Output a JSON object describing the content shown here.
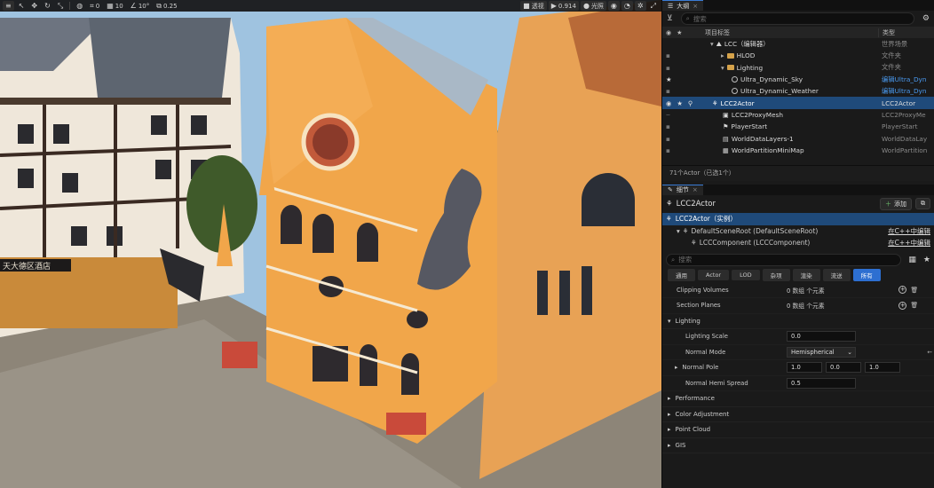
{
  "viewport_toolbar": {
    "grid_snap": "0",
    "grid_size": "10",
    "rotate_snap": "10°",
    "scale_snap": "0.25",
    "view_mode": "透视",
    "camera_speed": "0.914",
    "lit_mode": "光照"
  },
  "signs": {
    "shop_sign": "天大德区酒店"
  },
  "outliner": {
    "tab_title": "大纲",
    "search_placeholder": "搜索",
    "col_label": "项目标签",
    "col_type": "类型",
    "rows": [
      {
        "name": "LCC（编辑器）",
        "type": "世界场景",
        "kind": "world"
      },
      {
        "name": "HLOD",
        "type": "文件夹",
        "kind": "folder"
      },
      {
        "name": "Lighting",
        "type": "文件夹",
        "kind": "folder"
      },
      {
        "name": "Ultra_Dynamic_Sky",
        "type": "编辑Ultra_Dyn",
        "kind": "actor"
      },
      {
        "name": "Ultra_Dynamic_Weather",
        "type": "编辑Ultra_Dyn",
        "kind": "actor"
      },
      {
        "name": "LCC2Actor",
        "type": "LCC2Actor",
        "kind": "actor"
      },
      {
        "name": "LCC2ProxyMesh",
        "type": "LCC2ProxyMe",
        "kind": "actor"
      },
      {
        "name": "PlayerStart",
        "type": "PlayerStart",
        "kind": "actor"
      },
      {
        "name": "WorldDataLayers-1",
        "type": "WorldDataLay",
        "kind": "actor"
      },
      {
        "name": "WorldPartitionMiniMap",
        "type": "WorldPartition",
        "kind": "actor"
      }
    ],
    "status": "71个Actor（已选1个）"
  },
  "details": {
    "tab_title": "细节",
    "actor_name": "LCC2Actor",
    "add_label": "添加",
    "instance_label": "LCC2Actor（实例）",
    "components": [
      {
        "name": "DefaultSceneRoot (DefaultSceneRoot)",
        "link": "在C++中编辑"
      },
      {
        "name": "LCCComponent (LCCComponent)",
        "link": "在C++中编辑"
      }
    ],
    "search_placeholder": "搜索",
    "categories": [
      "通用",
      "Actor",
      "LOD",
      "杂项",
      "渲染",
      "流送",
      "所有"
    ],
    "active_category": "所有",
    "array_props": [
      {
        "label": "Clipping Volumes",
        "value": "0 数组 个元素"
      },
      {
        "label": "Section Planes",
        "value": "0 数组 个元素"
      }
    ],
    "lighting_group": "Lighting",
    "lighting_scale_label": "Lighting Scale",
    "lighting_scale_value": "0.0",
    "normal_mode_label": "Normal Mode",
    "normal_mode_value": "Hemispherical",
    "normal_pole_label": "Normal Pole",
    "normal_pole_x": "1.0",
    "normal_pole_y": "0.0",
    "normal_pole_z": "1.0",
    "normal_hemi_label": "Normal Hemi Spread",
    "normal_hemi_value": "0.5",
    "groups": [
      "Performance",
      "Color Adjustment",
      "Point Cloud",
      "GIS"
    ]
  }
}
